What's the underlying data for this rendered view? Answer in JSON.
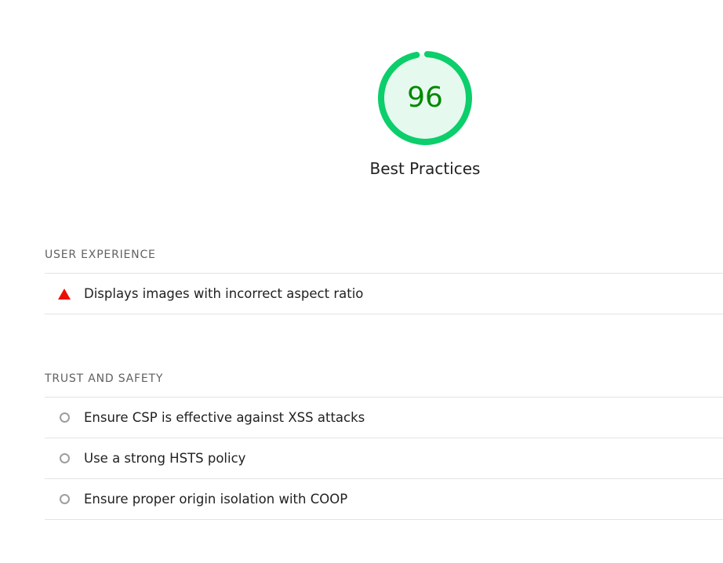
{
  "category": {
    "score": "96",
    "score_fraction": 0.96,
    "label": "Best Practices",
    "colors": {
      "pass_arc": "#0cce6b",
      "pass_fill": "#e6f9ef",
      "pass_text": "#008800"
    }
  },
  "groups": [
    {
      "title": "USER EXPERIENCE",
      "audits": [
        {
          "title": "Displays images with incorrect aspect ratio",
          "status_icon": "fail-triangle-icon",
          "color": "#eb0f00"
        }
      ]
    },
    {
      "title": "TRUST AND SAFETY",
      "audits": [
        {
          "title": "Ensure CSP is effective against XSS attacks",
          "status_icon": "neutral-circle-icon"
        },
        {
          "title": "Use a strong HSTS policy",
          "status_icon": "neutral-circle-icon"
        },
        {
          "title": "Ensure proper origin isolation with COOP",
          "status_icon": "neutral-circle-icon"
        }
      ]
    }
  ]
}
